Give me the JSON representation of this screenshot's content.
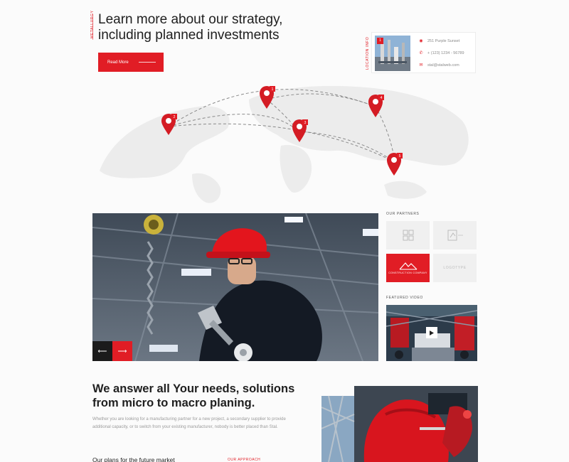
{
  "hero": {
    "vertical_label": "METALLURGY",
    "title": "Learn more about our strategy, including planned investments",
    "button_label": "Read More"
  },
  "location": {
    "vertical_label": "LOCATION INFO",
    "badge": "1",
    "address": "251 Purple Sunset",
    "phone": "+ (123) 1234 - 56789",
    "email": "stal@stalweb.com"
  },
  "map": {
    "pins": [
      "1",
      "2",
      "3",
      "4",
      "5"
    ]
  },
  "partners": {
    "label": "OUR PARTNERS",
    "featured_logo_text": "CONSTRUCTION COMPANY",
    "item4_text": "LOGOTYPE"
  },
  "video": {
    "label": "FEATURED VIDEO"
  },
  "needs": {
    "title": "We answer all Your needs, solutions from micro to macro planing.",
    "paragraph": "Whether you are looking for a manufacturing partner for a new project, a secondary supplier to provide additional capacity, or to switch from your existing manufacturer, nobody is better placed than Stal.",
    "subheading": "Our plans for the future market",
    "link": "OUR APPROACH"
  },
  "colors": {
    "accent": "#e11d25",
    "text": "#202020"
  }
}
